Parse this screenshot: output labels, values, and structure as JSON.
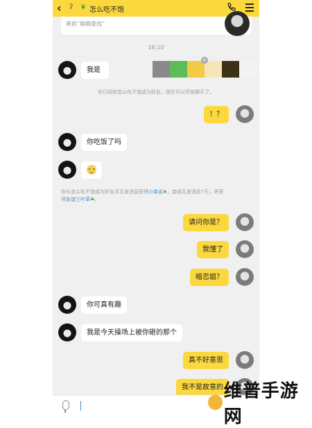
{
  "header": {
    "back_icon": "chevron-left-icon",
    "title": "怎么吃不饱",
    "title_prefix_icon": "leaf-icon"
  },
  "profile_card": {
    "signature": "来抓“稿稿查找”"
  },
  "chat": {
    "time": "16:10",
    "first_message_prefix": "我是",
    "swatch_colors": [
      "#8a8a8a",
      "#5dbb5a",
      "#f1cb45",
      "#f5e6b8",
      "#3c3317",
      "#f3f3f3"
    ],
    "system_notice_1": "你已经和怎么吃不饱成为好友，现在可以开始聊天了。",
    "system_notice_2": {
      "text_a": "你与怎么吃不饱成为好友并互发消息获得",
      "link_a": "小幸运",
      "text_b": "，连续互发消息7天，将获",
      "text_c": "得",
      "link_b": "友谊三叶草",
      "text_d": "。"
    },
    "messages": [
      {
        "side": "right",
        "text": "！？"
      },
      {
        "side": "left",
        "text": "你吃饭了吗"
      },
      {
        "side": "left",
        "emoji": "smile-emoji"
      },
      {
        "side": "right",
        "text": "请问你是？"
      },
      {
        "side": "right",
        "text": "我懂了"
      },
      {
        "side": "right",
        "text": "暗恋姐？"
      },
      {
        "side": "left",
        "text": "你可真有趣"
      },
      {
        "side": "left",
        "text": "我是今天操场上被你砸的那个"
      },
      {
        "side": "right",
        "text": "真不好意思"
      },
      {
        "side": "right",
        "text": "我不是故意的"
      }
    ]
  },
  "input_bar": {
    "mic_icon": "microphone-icon"
  },
  "watermark": {
    "text": "维普手游网"
  }
}
